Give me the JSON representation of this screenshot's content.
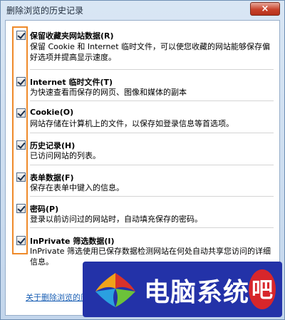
{
  "window": {
    "title": "删除浏览的历史记录",
    "close_label": "×"
  },
  "items": [
    {
      "title": "保留收藏夹网站数据(R)",
      "desc": "保留 Cookie 和 Internet 临时文件，可以使您收藏的网站能够保存偏好选项并提高显示速度。",
      "checked": true
    },
    {
      "title": "Internet 临时文件(T)",
      "desc": "为快速查看而保存的网页、图像和媒体的副本",
      "checked": true
    },
    {
      "title": "Cookie(O)",
      "desc": "网站存储在计算机上的文件，以保存如登录信息等首选项。",
      "checked": true
    },
    {
      "title": "历史记录(H)",
      "desc": "已访问网站的列表。",
      "checked": true
    },
    {
      "title": "表单数据(F)",
      "desc": "保存在表单中键入的信息。",
      "checked": true
    },
    {
      "title": "密码(P)",
      "desc": "登录以前访问过的网站时，自动填充保存的密码。",
      "checked": true
    },
    {
      "title": "InPrivate 筛选数据(I)",
      "desc": "InPrivate 筛选使用已保存数据检测网站在何处自动共享您访问的详细信息。",
      "checked": true
    }
  ],
  "footer": {
    "link_label": "关于删除浏览的历史"
  },
  "watermark": {
    "text": "电脑系统",
    "circled_char": "吧"
  },
  "colors": {
    "highlight": "#ef8a2a",
    "link": "#1a5fb4",
    "watermark_bg": "#2332a8"
  }
}
